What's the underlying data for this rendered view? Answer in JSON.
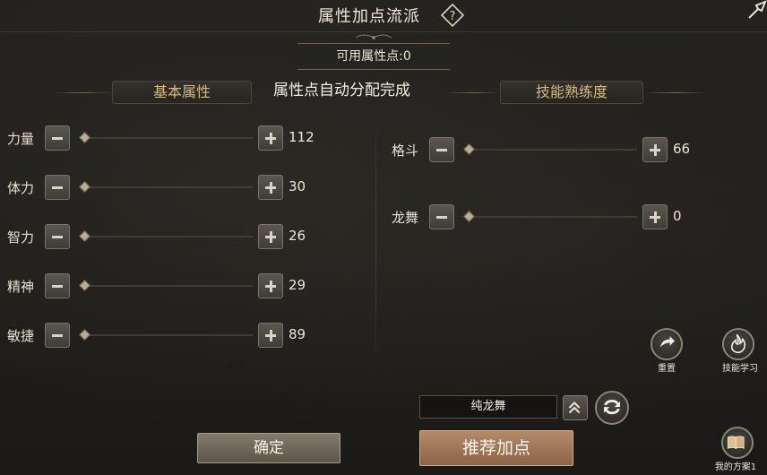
{
  "header": {
    "title": "属性加点流派",
    "help_icon": "question-diamond-icon",
    "pin_icon": "pin-icon"
  },
  "available_points": "可用属性点:0",
  "tabs": {
    "basic": "基本属性",
    "skill": "技能熟练度"
  },
  "auto_message": "属性点自动分配完成",
  "basic_attributes": [
    {
      "label": "力量",
      "value": "112"
    },
    {
      "label": "体力",
      "value": "30"
    },
    {
      "label": "智力",
      "value": "26"
    },
    {
      "label": "精神",
      "value": "29"
    },
    {
      "label": "敏捷",
      "value": "89"
    }
  ],
  "skills": [
    {
      "label": "格斗",
      "value": "66"
    },
    {
      "label": "龙舞",
      "value": "0"
    }
  ],
  "actions": {
    "reset": "重置",
    "skill_learn": "技能学习",
    "plan_select": "纯龙舞",
    "confirm": "确定",
    "recommend": "推荐加点",
    "my_plan": "我的方案1"
  },
  "colors": {
    "gold_text": "#d6b985",
    "recommend_button": "#a37a5c",
    "confirm_button": "#6f6a5c"
  }
}
